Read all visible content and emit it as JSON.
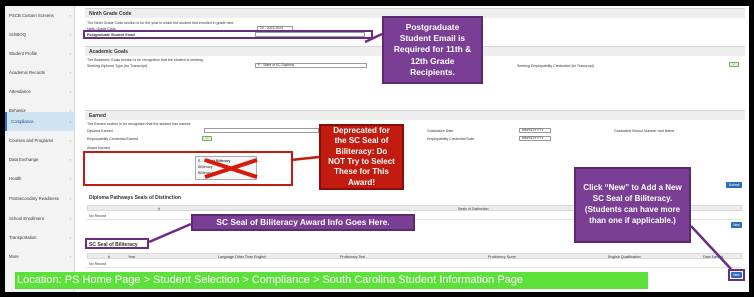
{
  "sidebar": {
    "items": [
      {
        "label": "PSCB Custom Screens"
      },
      {
        "label": "SchBOQ"
      },
      {
        "label": "Student Profile"
      },
      {
        "label": "Academic Records"
      },
      {
        "label": "Attendance"
      },
      {
        "label": "Behavior"
      },
      {
        "label": "Compliance"
      },
      {
        "label": "Courses and Programs"
      },
      {
        "label": "Data Exchange"
      },
      {
        "label": "Health"
      },
      {
        "label": "Postsecondary Readiness"
      },
      {
        "label": "School Enrollment"
      },
      {
        "label": "Transportation"
      },
      {
        "label": "More"
      }
    ]
  },
  "ninth_grade": {
    "title": "Ninth Grade Code",
    "description": "The Ninth Grade Code section is for the year in which the student first enrolled in grade nine.",
    "code_label": "Ninth Grade Code",
    "code_value": "20 - 2023-2024",
    "email_label": "Postgraduate Student Email",
    "email_value": ""
  },
  "academic_goals": {
    "title": "Academic Goals",
    "description": "The Academic Goals section is for recognition that the student is seeking:",
    "diploma_label": "Seeking Diploma Type (for Transcript)",
    "diploma_value": "P - State of SC Diploma",
    "employability_label": "Seeking Employability Credential (for Transcript)"
  },
  "earned": {
    "title": "Earned",
    "description": "The Earned section is for recognition that the student has earned:",
    "diploma_earned_label": "Diploma Earned",
    "employability_earned_label": "Employability Credential Earned",
    "award_earned_label": "Award Earned",
    "graduation_date_label": "Graduation Date",
    "employability_date_label": "Employability Credential Date",
    "date_placeholder": "MM/DD/YYYY",
    "grad_school_label": "Graduated School Number and Name",
    "award_options": [
      "S - Seal of Biliteracy",
      "Biliteracy",
      "Biliteracy"
    ],
    "submit_label": "Submit"
  },
  "pathways": {
    "title": "Diploma Pathways Seals of Distinction",
    "columns": [
      "#",
      "Seals of Distinction"
    ],
    "no_record": "No Record",
    "new_label": "New"
  },
  "biliteracy": {
    "title": "SC Seal of Biliteracy",
    "columns": [
      "#",
      "Year",
      "Language Other Than English",
      "Proficiency Test",
      "Proficiency Score",
      "English Qualification",
      "Date Earned"
    ],
    "no_record": "No Record",
    "new_label": "New"
  },
  "callouts": {
    "postgrad": "Postgraduate Student Email is Required for 11th & 12th Grade Recipients.",
    "deprecated": "Deprecated for the SC Seal of Biliteracy: Do NOT Try to Select These for This Award!",
    "award_info": "SC Seal of Biliteracy Award Info Goes Here.",
    "click_new": "Click “New” to Add a New SC Seal of Biliteracy. (Students can have more than one if applicable.)"
  },
  "location_banner": "Location: PS Home Page > Student Selection > Compliance > South Carolina Student Information Page",
  "colors": {
    "callout_purple": "#7a3f94",
    "callout_red": "#c21b0f",
    "banner_green": "#5ce03a",
    "button_blue": "#2d6db5"
  }
}
